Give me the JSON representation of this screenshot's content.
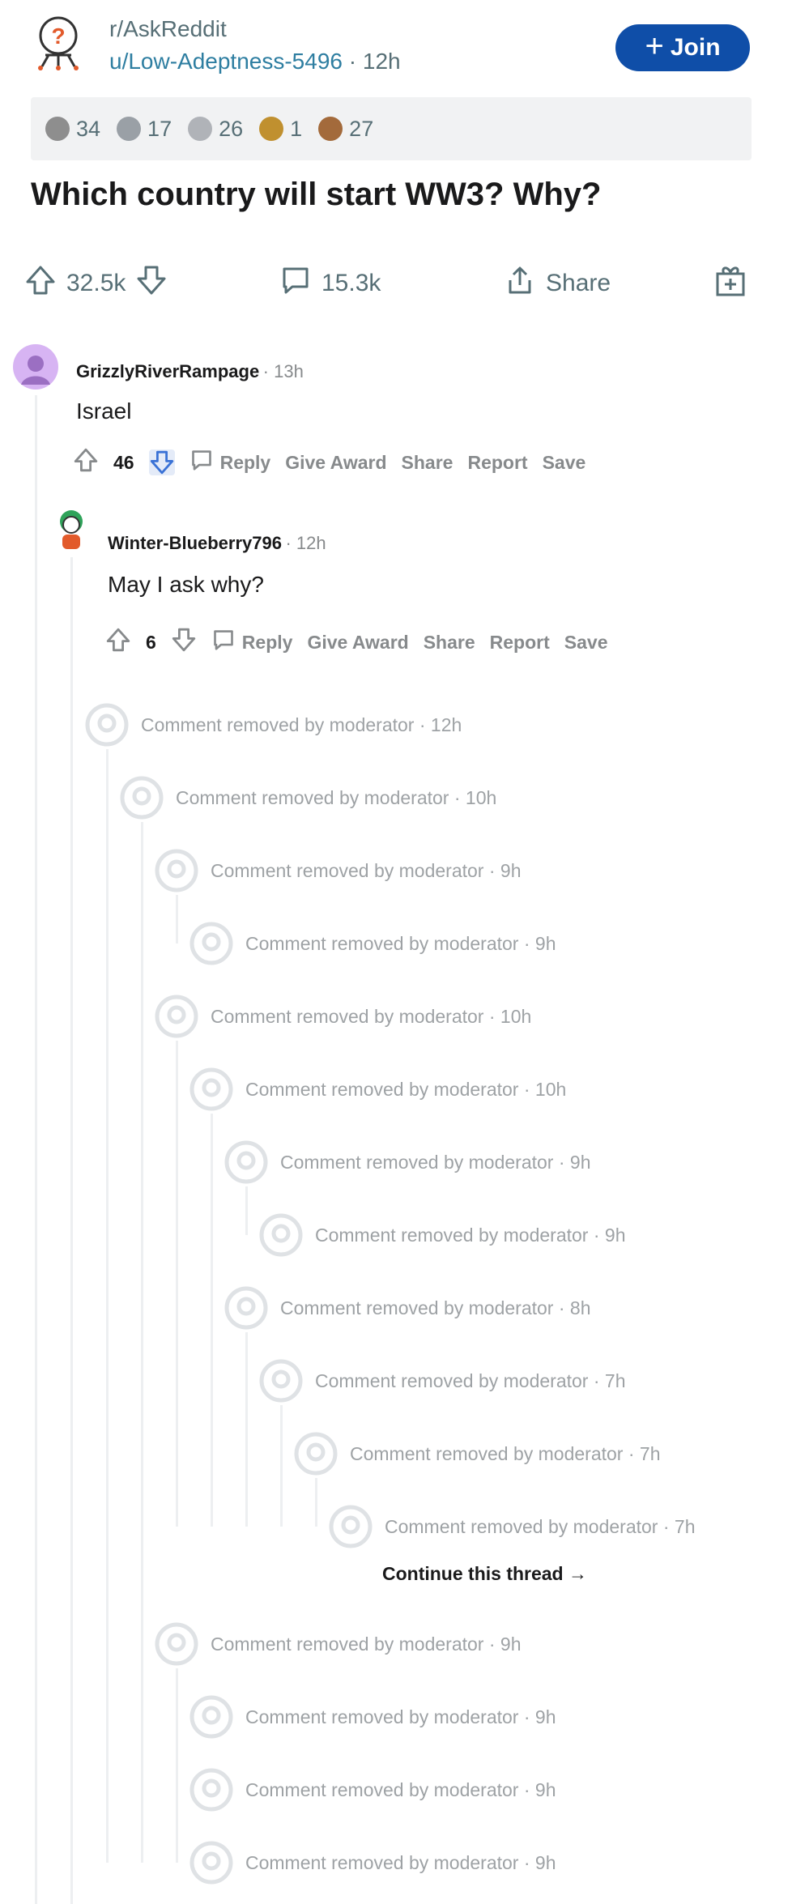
{
  "post": {
    "subreddit": "r/AskReddit",
    "author": "u/Low-Adeptness-5496",
    "separator": "·",
    "age": "12h",
    "join_label": "Join",
    "awards": [
      {
        "icon": "award-icon",
        "count": "34",
        "color": "#8e8e8e"
      },
      {
        "icon": "helpful-icon",
        "count": "17",
        "color": "#9aa0a6"
      },
      {
        "icon": "silver-icon",
        "count": "26",
        "color": "#b0b3b8"
      },
      {
        "icon": "hugz-icon",
        "count": "1",
        "color": "#c0902f"
      },
      {
        "icon": "bear-icon",
        "count": "27",
        "color": "#a36a3b"
      }
    ],
    "title": "Which country will start WW3? Why?",
    "upvotes": "32.5k",
    "comments": "15.3k",
    "share_label": "Share"
  },
  "comments": [
    {
      "author": "GrizzlyRiverRampage",
      "age": "13h",
      "body": "Israel",
      "score": "46",
      "actions": {
        "reply": "Reply",
        "award": "Give Award",
        "share": "Share",
        "report": "Report",
        "save": "Save"
      }
    },
    {
      "author": "Winter-Blueberry796",
      "age": "12h",
      "body": "May I ask why?",
      "score": "6",
      "actions": {
        "reply": "Reply",
        "award": "Give Award",
        "share": "Share",
        "report": "Report",
        "save": "Save"
      }
    }
  ],
  "removed_text": "Comment removed by moderator",
  "removed": [
    {
      "age": "12h"
    },
    {
      "age": "10h"
    },
    {
      "age": "9h"
    },
    {
      "age": "9h"
    },
    {
      "age": "10h"
    },
    {
      "age": "10h"
    },
    {
      "age": "9h"
    },
    {
      "age": "9h"
    },
    {
      "age": "8h"
    },
    {
      "age": "7h"
    },
    {
      "age": "7h"
    },
    {
      "age": "7h"
    },
    {
      "age": "9h"
    },
    {
      "age": "9h"
    },
    {
      "age": "9h"
    },
    {
      "age": "9h"
    }
  ],
  "continue_label": "Continue this thread"
}
